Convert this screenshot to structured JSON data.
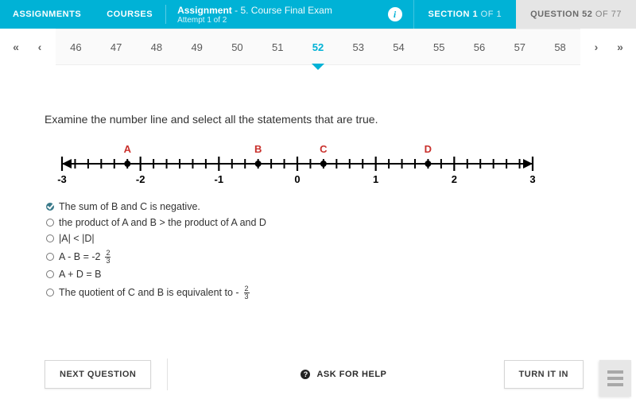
{
  "header": {
    "assignments": "ASSIGNMENTS",
    "courses": "COURSES",
    "assignment_label": "Assignment",
    "assignment_name": "- 5. Course Final Exam",
    "attempt": "Attempt 1 of 2",
    "info_glyph": "i",
    "section": "SECTION 1",
    "section_of": "OF 1",
    "question": "QUESTION 52",
    "question_of": "OF 77"
  },
  "qnav": {
    "first_glyph": "«",
    "prev_glyph": "‹",
    "next_glyph": "›",
    "last_glyph": "»",
    "numbers": [
      "46",
      "47",
      "48",
      "49",
      "50",
      "51",
      "52",
      "53",
      "54",
      "55",
      "56",
      "57",
      "58"
    ],
    "current": "52"
  },
  "prompt": "Examine the number line and select all the statements that are true.",
  "numberline": {
    "min": -3,
    "max": 3,
    "ticks": [
      "-3",
      "-2",
      "-1",
      "0",
      "1",
      "2",
      "3"
    ],
    "points": [
      {
        "label": "A",
        "value": -2.166
      },
      {
        "label": "B",
        "value": -0.5
      },
      {
        "label": "C",
        "value": 0.333
      },
      {
        "label": "D",
        "value": 1.666
      }
    ]
  },
  "options": [
    {
      "text": "The sum of B and C is negative.",
      "checked": true
    },
    {
      "text": "the product of A and B > the product of A and D",
      "checked": false
    },
    {
      "text": "|A| < |D|",
      "checked": false
    },
    {
      "text": "A - B = -2",
      "fraction": {
        "num": "2",
        "den": "3"
      },
      "checked": false
    },
    {
      "text": "A + D = B",
      "checked": false
    },
    {
      "text": "The quotient of C and B is equivalent to -",
      "fraction": {
        "num": "2",
        "den": "3"
      },
      "checked": false
    }
  ],
  "footer": {
    "next": "NEXT QUESTION",
    "help_glyph": "?",
    "help": "ASK FOR HELP",
    "turnin": "TURN IT IN"
  }
}
